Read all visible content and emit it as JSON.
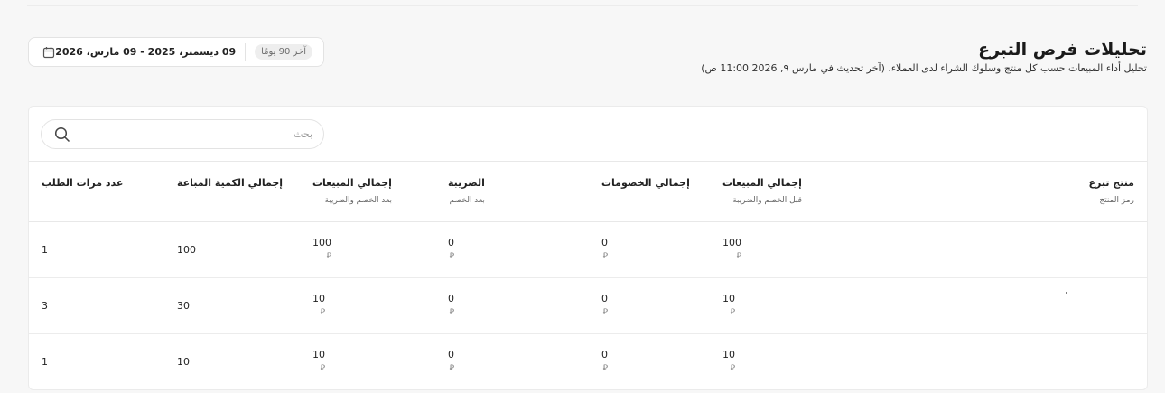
{
  "header": {
    "title": "تحليلات فرص التبرع",
    "subtitle": "تحليل أداء المبيعات حسب كل منتج وسلوك الشراء لدى العملاء. (آخر تحديث في مارس ٩, 2026 11:00 ص)"
  },
  "date_filter": {
    "preset": "آخر 90 يومًا",
    "range": "09 ديسمبر، 2025 - 09 مارس، 2026",
    "icon": "calendar-icon"
  },
  "search": {
    "placeholder": "بحث",
    "value": "",
    "icon": "search-icon"
  },
  "table": {
    "columns": [
      {
        "key": "product",
        "label": "منتج تبرع",
        "sub": "رمز المنتج"
      },
      {
        "key": "gross_sales",
        "label": "إجمالي المبيعات",
        "sub": "قبل الخصم والضريبة"
      },
      {
        "key": "discounts",
        "label": "إجمالي الخصومات",
        "sub": ""
      },
      {
        "key": "tax",
        "label": "الضريبة",
        "sub": "بعد الخصم"
      },
      {
        "key": "net_sales",
        "label": "إجمالي المبيعات",
        "sub": "بعد الخصم والضريبة"
      },
      {
        "key": "quantity",
        "label": "إجمالي الكمية المباعة",
        "sub": ""
      },
      {
        "key": "orders",
        "label": "عدد مرات الطلب",
        "sub": ""
      }
    ],
    "currency_symbol": "⃁",
    "rows": [
      {
        "product": "",
        "gross_sales": "100",
        "discounts": "0",
        "tax": "0",
        "net_sales": "100",
        "quantity": "100",
        "orders": "1"
      },
      {
        "product": "",
        "gross_sales": "10",
        "discounts": "0",
        "tax": "0",
        "net_sales": "10",
        "quantity": "30",
        "orders": "3"
      },
      {
        "product": "",
        "gross_sales": "10",
        "discounts": "0",
        "tax": "0",
        "net_sales": "10",
        "quantity": "10",
        "orders": "1"
      }
    ]
  }
}
